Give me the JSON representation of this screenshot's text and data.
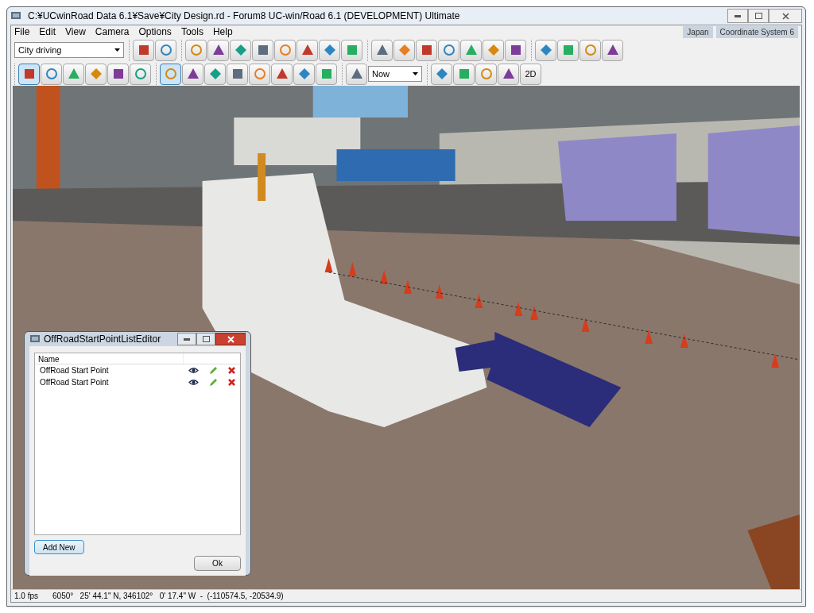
{
  "window": {
    "title": "C:¥UCwinRoad Data 6.1¥Save¥City Design.rd - Forum8 UC-win/Road 6.1 (DEVELOPMENT) Ultimate"
  },
  "menu": [
    "File",
    "Edit",
    "View",
    "Camera",
    "Options",
    "Tools",
    "Help"
  ],
  "region_labels": [
    "Japan",
    "Coordinate System 6"
  ],
  "toolbar_1": {
    "scenario_select": {
      "value": "City driving"
    },
    "groups": [
      [
        {
          "pressed": false
        },
        {
          "pressed": false
        }
      ],
      [
        {
          "pressed": false
        },
        {
          "pressed": false
        },
        {
          "pressed": false
        },
        {
          "pressed": false
        },
        {
          "pressed": false
        },
        {
          "pressed": false
        },
        {
          "pressed": false
        },
        {
          "pressed": false
        }
      ],
      [
        {
          "pressed": false
        },
        {
          "pressed": false
        },
        {
          "pressed": false
        },
        {
          "pressed": false
        },
        {
          "pressed": false
        },
        {
          "pressed": false
        },
        {
          "pressed": false
        }
      ],
      [
        {
          "pressed": false
        },
        {
          "pressed": false
        },
        {
          "pressed": false
        },
        {
          "pressed": false
        }
      ]
    ]
  },
  "toolbar_2": {
    "time_select": {
      "value": "Now"
    },
    "groups": [
      [
        {
          "pressed": true
        },
        {
          "pressed": false
        },
        {
          "pressed": false
        },
        {
          "pressed": false
        },
        {
          "pressed": false
        },
        {
          "pressed": false
        }
      ],
      [
        {
          "pressed": true
        },
        {
          "pressed": false
        },
        {
          "pressed": false
        },
        {
          "pressed": false
        },
        {
          "pressed": false
        },
        {
          "pressed": false
        },
        {
          "pressed": false
        },
        {
          "pressed": false
        }
      ],
      [
        {
          "pressed": false
        }
      ],
      [
        {
          "pressed": false
        },
        {
          "pressed": false
        },
        {
          "pressed": false
        },
        {
          "pressed": false
        },
        {
          "pressed": false,
          "label": "2D"
        }
      ]
    ]
  },
  "dialog": {
    "title": "OffRoadStartPointListEditor",
    "columns": [
      "Name"
    ],
    "rows": [
      {
        "name": "OffRoad Start Point"
      },
      {
        "name": "OffRoad Start Point"
      }
    ],
    "buttons": {
      "add": "Add New",
      "ok": "Ok"
    }
  },
  "status_bar": {
    "fps": "1.0 fps",
    "position": "6050°   25' 44.1\" N, 346102°   0' 17.4\" W  -  (-110574.5, -20534.9)"
  }
}
